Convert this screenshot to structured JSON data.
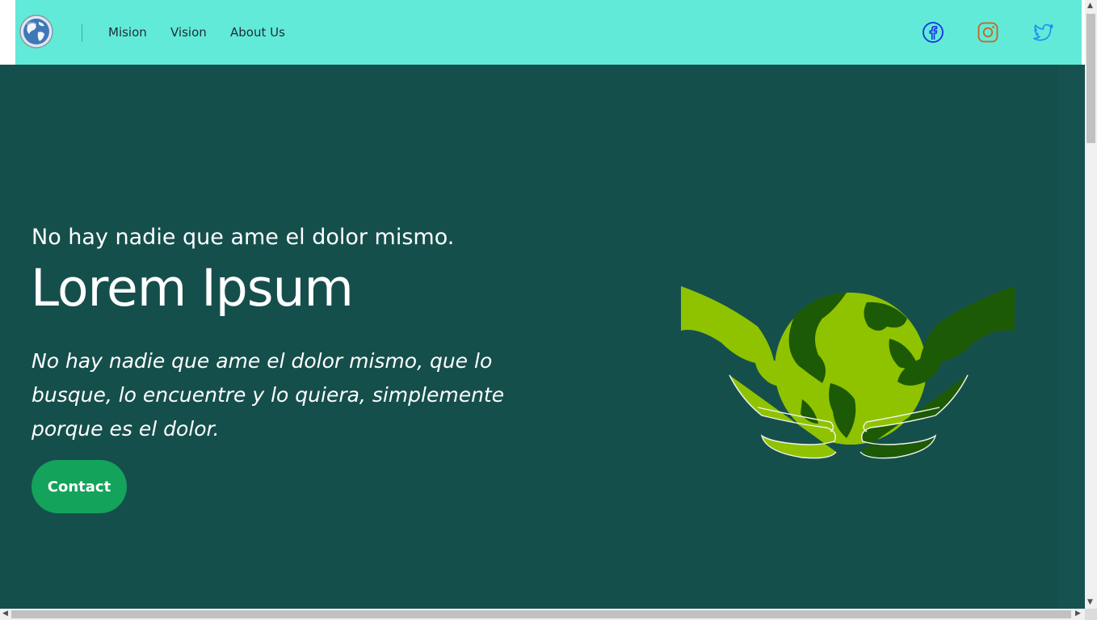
{
  "navbar": {
    "links": [
      {
        "label": "Mision"
      },
      {
        "label": "Vision"
      },
      {
        "label": "About Us"
      }
    ],
    "social": [
      {
        "icon": "facebook-icon",
        "color": "#1a32e0"
      },
      {
        "icon": "instagram-icon",
        "color": "#c4671e"
      },
      {
        "icon": "twitter-icon",
        "color": "#1d8ef0"
      }
    ],
    "background": "#61ead8"
  },
  "hero": {
    "kicker": "No hay nadie que ame el dolor mismo.",
    "headline": "Lorem Ipsum",
    "lead": "No hay nadie que ame el dolor mismo, que lo busque, lo encuentre y lo quiera, simplemente porque es el dolor.",
    "cta_label": "Contact",
    "background": "#154f4c",
    "cta_color": "#13a35b"
  }
}
